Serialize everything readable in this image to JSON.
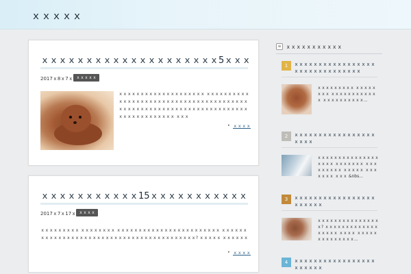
{
  "header": {
    "site_title": "ｘｘｘｘｘ"
  },
  "posts": [
    {
      "title": "ｘｘｘｘｘｘｘｘｘｘｘｘｘｘｘｘｘｘｘｘ5ｘｘｘｘｘｘ",
      "date": "2017ｘ8ｘ7ｘ",
      "category": "ｘｘｘｘｘ",
      "excerpt": "ｘｘｘｘｘｘｘｘｘｘｘｘｘｘｘｘｘｘｘｘ ｘｘｘｘｘｘｘｘｘｘｘｘｘｘｘｘｘｘｘｘｘｘｘｘｘｘｘｘｘｘｘｘｘｘｘｘｘｘｘｘ ｘｘｘｘｘｘｘｘｘｘｘｘｘｘｘｘｘｘｘｘｘｘｘｘｘｘｘｘｘｘｘｘｘｘｘｘｘｘｘｘｘｘｘ ｘｘｘ",
      "more": "ｘｘｘｘ"
    },
    {
      "title": "ｘｘｘｘｘｘｘｘｘｘｘ15ｘｘｘｘｘｘｘｘｘｘｘｘｘｘｘｘ",
      "date": "2017ｘ7ｘ17ｘ",
      "category": "ｘｘｘｘ",
      "excerpt": "ｘｘｘｘｘｘｘｘｘ ｘｘｘｘｘｘｘｘ ｘｘｘｘｘｘｘｘｘｘｘｘｘｘｘｘｘｘｘｘｘｘｘｘ ｘｘｘｘｘｘｘｘｘｘｘｘｘｘｘｘｘｘｘｘｘｘｘｘｘｘｘｘｘｘｘｘｘｘｘｘｘｘｘｘｘｘ? ｘｘｘｘｘ ｘｘｘｘｘｘｘｘｘｘｘｘｘｘ",
      "more": "ｘｘｘｘ"
    }
  ],
  "sidebar": {
    "widget_title": "ｘｘｘｘｘｘｘｘｘｘｘ",
    "ranking": [
      {
        "num": "1",
        "color": "#e1b449",
        "title": "ｘｘｘｘｘｘｘｘｘｘｘｘｘｘｘｘｘｘｘｘｘｘｘｘｘｘｘｘｘｘｘ",
        "text": "ｘｘｘｘｘｘｘｘｘ ｘｘｘｘｘｘｘｘ ｘｘｘｘｘｘｘｘｘｘｘｘ ｘｘｘｘｘｘｘｘｘｘ..."
      },
      {
        "num": "2",
        "color": "#bfbdb8",
        "title": "ｘｘｘｘｘｘｘｘｘｘｘｘｘｘｘｘｘｘｘｘｘ",
        "text": "ｘｘｘｘｘｘｘｘｘｘｘｘｘｘｘｘｘｘｘ ｘｘｘｘｘｘｘ ｘｘｘｘｘｘｘｘｘ ｘｘｘｘｘ ｘｘｘｘｘｘｘ ｘｘｘ &nbs..."
      },
      {
        "num": "3",
        "color": "#c28a3a",
        "title": "ｘｘｘｘｘｘｘｘｘｘｘｘｘｘｘｘｘｘｘｘｘｘｘ",
        "text": "ｘｘｘｘｘｘｘｘｘｘｘｘｘｘｘｘ? ｘｘｘｘｘｘｘｘｘｘｘｘｘｘｘｘｘｘ ｘｘｘｘ ｘｘｘｘｘｘｘｘｘｘｘｘｘｘ..."
      },
      {
        "num": "4",
        "color": "#6ab5d6",
        "title": "ｘｘｘｘｘｘｘｘｘｘｘｘｘｘｘｘｘｘｘｘｘｘｘ",
        "text": ""
      }
    ]
  }
}
